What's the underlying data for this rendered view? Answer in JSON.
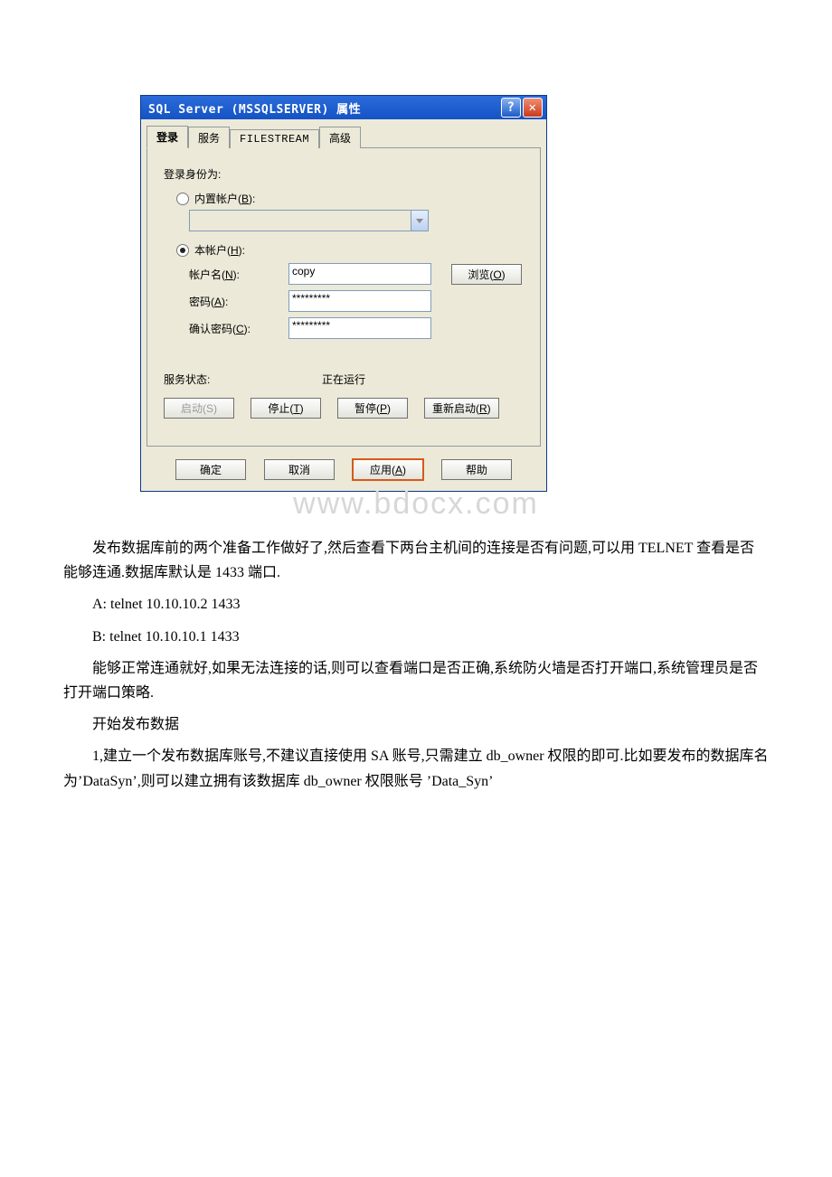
{
  "dialog": {
    "title": "SQL Server (MSSQLSERVER) 属性",
    "tabs": {
      "login": "登录",
      "service": "服务",
      "filestream": "FILESTREAM",
      "advanced": "高级"
    },
    "login_as_label": "登录身份为:",
    "builtin_label_pre": "内置帐户(",
    "builtin_hot": "B",
    "builtin_label_post": "):",
    "local_label_pre": "本帐户(",
    "local_hot": "H",
    "local_label_post": "):",
    "account_label_pre": "帐户名(",
    "account_hot": "N",
    "account_label_post": "):",
    "account_value": "copy",
    "browse_pre": "浏览(",
    "browse_hot": "O",
    "browse_post": ")",
    "password_label_pre": "密码(",
    "password_hot": "A",
    "password_label_post": "):",
    "password_mask": "*********",
    "confirm_label_pre": "确认密码(",
    "confirm_hot": "C",
    "confirm_label_post": "):",
    "confirm_mask": "*********",
    "status_label": "服务状态:",
    "status_value": "正在运行",
    "start_pre": "启动(",
    "start_hot": "S",
    "start_post": ")",
    "stop_pre": "停止(",
    "stop_hot": "T",
    "stop_post": ")",
    "pause_pre": "暂停(",
    "pause_hot": "P",
    "pause_post": ")",
    "restart_pre": "重新启动(",
    "restart_hot": "R",
    "restart_post": ")",
    "ok": "确定",
    "cancel": "取消",
    "apply_pre": "应用(",
    "apply_hot": "A",
    "apply_post": ")",
    "help": "帮助"
  },
  "watermark": "www.bdocx.com",
  "article": {
    "p1": "发布数据库前的两个准备工作做好了,然后查看下两台主机间的连接是否有问题,可以用 TELNET 查看是否能够连通.数据库默认是 1433 端口.",
    "p2": "A: telnet 10.10.10.2 1433",
    "p3": "B: telnet 10.10.10.1 1433",
    "p4": "能够正常连通就好,如果无法连接的话,则可以查看端口是否正确,系统防火墙是否打开端口,系统管理员是否打开端口策略.",
    "p5": "开始发布数据",
    "p6": "1,建立一个发布数据库账号,不建议直接使用 SA 账号,只需建立 db_owner 权限的即可.比如要发布的数据库名为’DataSyn’,则可以建立拥有该数据库 db_owner 权限账号 ’Data_Syn’"
  }
}
